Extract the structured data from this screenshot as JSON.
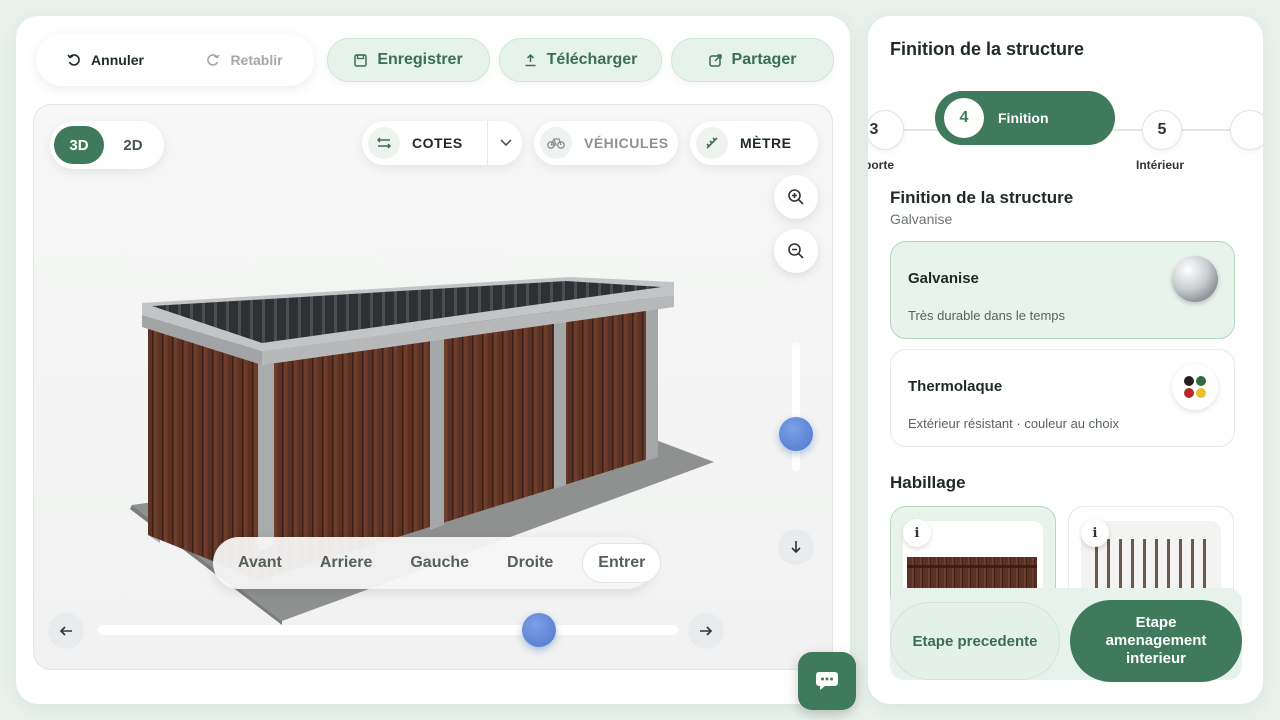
{
  "toolbar": {
    "undo_label": "Annuler",
    "redo_label": "Retablir",
    "save_label": "Enregistrer",
    "download_label": "Télécharger",
    "share_label": "Partager"
  },
  "viewer": {
    "mode_3d": "3D",
    "mode_2d": "2D",
    "active_mode": "3D",
    "cotes_label": "COTES",
    "vehicules_label": "VÉHICULES",
    "metre_label": "MÈTRE",
    "views": [
      "Avant",
      "Arriere",
      "Gauche",
      "Droite",
      "Entrer"
    ],
    "active_view": "Entrer",
    "vertical_slider_value": 0.72,
    "horizontal_slider_value": 0.76
  },
  "panel": {
    "title": "Finition de la structure",
    "steps": [
      {
        "num": "3",
        "label": "porte"
      },
      {
        "num": "4",
        "label": "Finition"
      },
      {
        "num": "5",
        "label": "Intérieur"
      }
    ],
    "active_step": "4",
    "section_title": "Finition de la structure",
    "section_value": "Galvanise",
    "options": [
      {
        "name": "Galvanise",
        "desc": "Très durable dans le temps"
      },
      {
        "name": "Thermolaque",
        "desc": "Extérieur résistant · couleur au choix"
      }
    ],
    "cladding_title": "Habillage",
    "info_glyph": "i",
    "prev_label": "Etape precedente",
    "next_label": "Etape amenagement interieur"
  },
  "colors": {
    "accent": "#3f7a5c",
    "accent_light": "#e6f3ea",
    "slider_blue": "#4f78cc",
    "wood": "#5b3223"
  },
  "icons": {
    "undo": "undo-icon",
    "redo": "redo-icon",
    "save": "save-icon",
    "download": "download-icon",
    "share": "share-icon",
    "dimensions": "dimensions-icon",
    "bike": "bike-icon",
    "ruler": "ruler-icon",
    "zoom_in": "zoom-in-icon",
    "zoom_out": "zoom-out-icon",
    "chat": "chat-icon"
  }
}
